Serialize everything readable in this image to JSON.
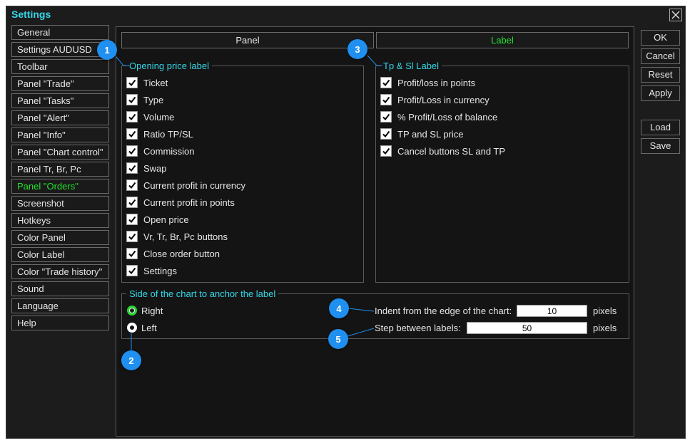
{
  "window": {
    "title": "Settings"
  },
  "sidebar": {
    "items": [
      {
        "label": "General"
      },
      {
        "label": "Settings AUDUSD"
      },
      {
        "label": "Toolbar"
      },
      {
        "label": "Panel \"Trade\""
      },
      {
        "label": "Panel \"Tasks\""
      },
      {
        "label": "Panel \"Alert\""
      },
      {
        "label": "Panel \"Info\""
      },
      {
        "label": "Panel \"Chart control\""
      },
      {
        "label": "Panel Tr, Br, Pc"
      },
      {
        "label": "Panel \"Orders\"",
        "active": true
      },
      {
        "label": "Screenshot"
      },
      {
        "label": "Hotkeys"
      },
      {
        "label": "Color Panel"
      },
      {
        "label": "Color Label"
      },
      {
        "label": "Color \"Trade history\""
      },
      {
        "label": "Sound"
      },
      {
        "label": "Language"
      },
      {
        "label": "Help"
      }
    ]
  },
  "tabs": [
    {
      "label": "Panel"
    },
    {
      "label": "Label",
      "active": true
    }
  ],
  "opening_group": {
    "legend": "Opening price label",
    "items": [
      {
        "label": "Ticket",
        "checked": true
      },
      {
        "label": "Type",
        "checked": true
      },
      {
        "label": "Volume",
        "checked": true
      },
      {
        "label": "Ratio TP/SL",
        "checked": true
      },
      {
        "label": "Commission",
        "checked": true
      },
      {
        "label": "Swap",
        "checked": true
      },
      {
        "label": "Current profit in currency",
        "checked": true
      },
      {
        "label": "Current profit in points",
        "checked": true
      },
      {
        "label": "Open price",
        "checked": true
      },
      {
        "label": "Vr, Tr, Br, Pc buttons",
        "checked": true
      },
      {
        "label": "Close order button",
        "checked": true
      },
      {
        "label": "Settings",
        "checked": true
      }
    ]
  },
  "tpsl_group": {
    "legend": "Tp & Sl Label",
    "items": [
      {
        "label": "Profit/loss in points",
        "checked": true
      },
      {
        "label": "Profit/Loss in currency",
        "checked": true
      },
      {
        "label": "% Profit/Loss of balance",
        "checked": true
      },
      {
        "label": "TP and SL price",
        "checked": true
      },
      {
        "label": "Cancel buttons SL and TP",
        "checked": true
      }
    ]
  },
  "anchor_group": {
    "legend": "Side of the chart to anchor the label",
    "right_label": "Right",
    "left_label": "Left",
    "selected": "Right",
    "indent_label": "Indent from the edge of the chart:",
    "indent_value": "10",
    "indent_unit": "pixels",
    "step_label": "Step between labels:",
    "step_value": "50",
    "step_unit": "pixels"
  },
  "buttons": {
    "ok": "OK",
    "cancel": "Cancel",
    "reset": "Reset",
    "apply": "Apply",
    "load": "Load",
    "save": "Save"
  },
  "callouts": [
    "1",
    "2",
    "3",
    "4",
    "5"
  ],
  "colors": {
    "accent": "#35d7e8",
    "active": "#22e02c",
    "badge": "#1f8ff0",
    "background": "#1c1c1c"
  }
}
